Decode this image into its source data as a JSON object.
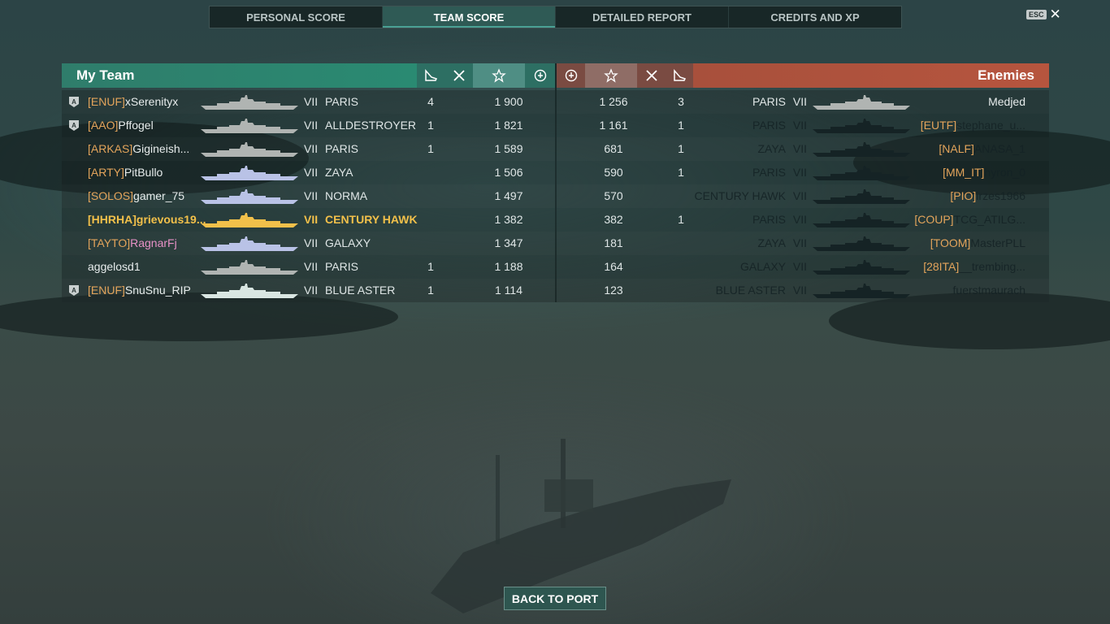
{
  "tabs": [
    {
      "label": "PERSONAL SCORE",
      "active": false
    },
    {
      "label": "TEAM SCORE",
      "active": true
    },
    {
      "label": "DETAILED REPORT",
      "active": false
    },
    {
      "label": "CREDITS AND XP",
      "active": false
    }
  ],
  "esc": {
    "badge": "ESC",
    "close_icon": "close-icon"
  },
  "my_team": {
    "title": "My Team",
    "header_color": "#2f7d6b",
    "columns": [
      "planes-destroyed-icon",
      "ships-destroyed-icon",
      "experience-star-icon",
      "base-capture-icon"
    ],
    "players": [
      {
        "badge": true,
        "clan": "[ENUF]",
        "name": "xSerenityx",
        "tier": "VII",
        "ship": "PARIS",
        "ship_color": "#b0b4b2",
        "ships_destroyed": "4",
        "xp": "1 900"
      },
      {
        "badge": true,
        "clan": "[AAO]",
        "name": "Pffogel",
        "tier": "VII",
        "ship": "ALLDESTROYER",
        "ship_color": "#b0b4b2",
        "ships_destroyed": "1",
        "xp": "1 821"
      },
      {
        "badge": false,
        "clan": "[ARKAS]",
        "name": "Gigineish...",
        "tier": "VII",
        "ship": "PARIS",
        "ship_color": "#b0b4b2",
        "ships_destroyed": "1",
        "xp": "1 589"
      },
      {
        "badge": false,
        "clan": "[ARTY]",
        "name": "PitBullo",
        "tier": "VII",
        "ship": "ZAYA",
        "ship_color": "#b9c2e6",
        "ships_destroyed": "",
        "xp": "1 506"
      },
      {
        "badge": false,
        "clan": "[SOLOS]",
        "name": "gamer_75",
        "tier": "VII",
        "ship": "NORMA",
        "ship_color": "#b9c2e6",
        "ships_destroyed": "",
        "xp": "1 497"
      },
      {
        "badge": false,
        "clan": "[HHRHA]",
        "name": "grievous19...",
        "tier": "VII",
        "ship": "CENTURY HAWK",
        "ship_color": "#f2c04a",
        "ships_destroyed": "",
        "xp": "1 382",
        "me": true
      },
      {
        "badge": false,
        "clan": "[TAYTO]",
        "name": "RagnarFj",
        "tier": "VII",
        "ship": "GALAXY",
        "ship_color": "#b9c2e6",
        "ships_destroyed": "",
        "xp": "1 347",
        "pink": true
      },
      {
        "badge": false,
        "clan": "",
        "name": "aggelosd1",
        "tier": "VII",
        "ship": "PARIS",
        "ship_color": "#b0b4b2",
        "ships_destroyed": "1",
        "xp": "1 188"
      },
      {
        "badge": true,
        "clan": "[ENUF]",
        "name": "SnuSnu_RIP",
        "tier": "VII",
        "ship": "BLUE ASTER",
        "ship_color": "#d9e6e2",
        "ships_destroyed": "1",
        "xp": "1 114"
      }
    ]
  },
  "enemies": {
    "title": "Enemies",
    "header_color": "#b6503a",
    "columns": [
      "base-capture-icon",
      "experience-star-icon",
      "ships-destroyed-icon",
      "planes-destroyed-icon"
    ],
    "players": [
      {
        "xp": "1 256",
        "ships_destroyed": "3",
        "ship": "PARIS",
        "tier": "VII",
        "clan": "",
        "name": "Medjed",
        "alive": true
      },
      {
        "xp": "1 161",
        "ships_destroyed": "1",
        "ship": "PARIS",
        "tier": "VII",
        "clan": "[EUTF]",
        "name": "stephane_u...",
        "alive": false
      },
      {
        "xp": "681",
        "ships_destroyed": "1",
        "ship": "ZAYA",
        "tier": "VII",
        "clan": "[NALF]",
        "name": "ANASA_1",
        "alive": false
      },
      {
        "xp": "590",
        "ships_destroyed": "1",
        "ship": "PARIS",
        "tier": "VII",
        "clan": "[MM_IT]",
        "name": "hyron_0",
        "alive": false
      },
      {
        "xp": "570",
        "ships_destroyed": "",
        "ship": "CENTURY HAWK",
        "tier": "VII",
        "clan": "[PIO]",
        "name": "irzes1966",
        "alive": false
      },
      {
        "xp": "382",
        "ships_destroyed": "1",
        "ship": "PARIS",
        "tier": "VII",
        "clan": "[COUP]",
        "name": "TCG_ATILG...",
        "alive": false
      },
      {
        "xp": "181",
        "ships_destroyed": "",
        "ship": "ZAYA",
        "tier": "VII",
        "clan": "[TOOM]",
        "name": "MasterPLL",
        "alive": false
      },
      {
        "xp": "164",
        "ships_destroyed": "",
        "ship": "GALAXY",
        "tier": "VII",
        "clan": "[28ITA]",
        "name": "__trembing...",
        "alive": false
      },
      {
        "xp": "123",
        "ships_destroyed": "",
        "ship": "BLUE ASTER",
        "tier": "VII",
        "clan": "",
        "name": "fuerstmaurach",
        "alive": false
      }
    ]
  },
  "back_button": {
    "label": "BACK TO PORT"
  }
}
